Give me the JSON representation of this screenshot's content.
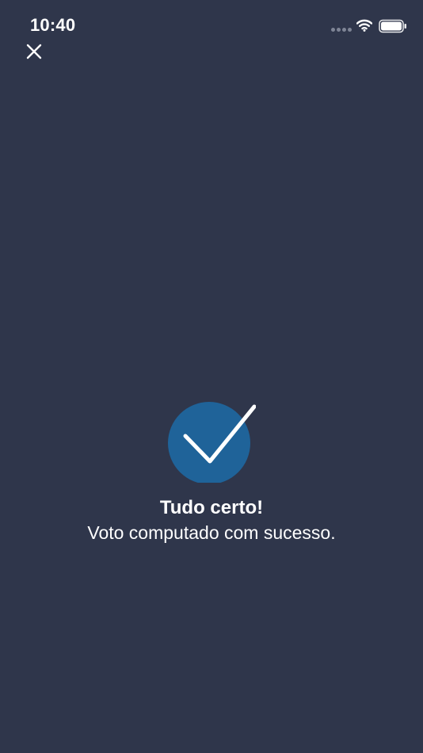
{
  "status_bar": {
    "time": "10:40",
    "icons": [
      "signal-dots-icon",
      "wifi-icon",
      "battery-icon"
    ]
  },
  "header": {
    "close_icon": "close-icon"
  },
  "success": {
    "icon": "check-icon",
    "title": "Tudo certo!",
    "message": "Voto computado com sucesso.",
    "accent_color": "#1f6399",
    "background_color": "#2f364b"
  }
}
